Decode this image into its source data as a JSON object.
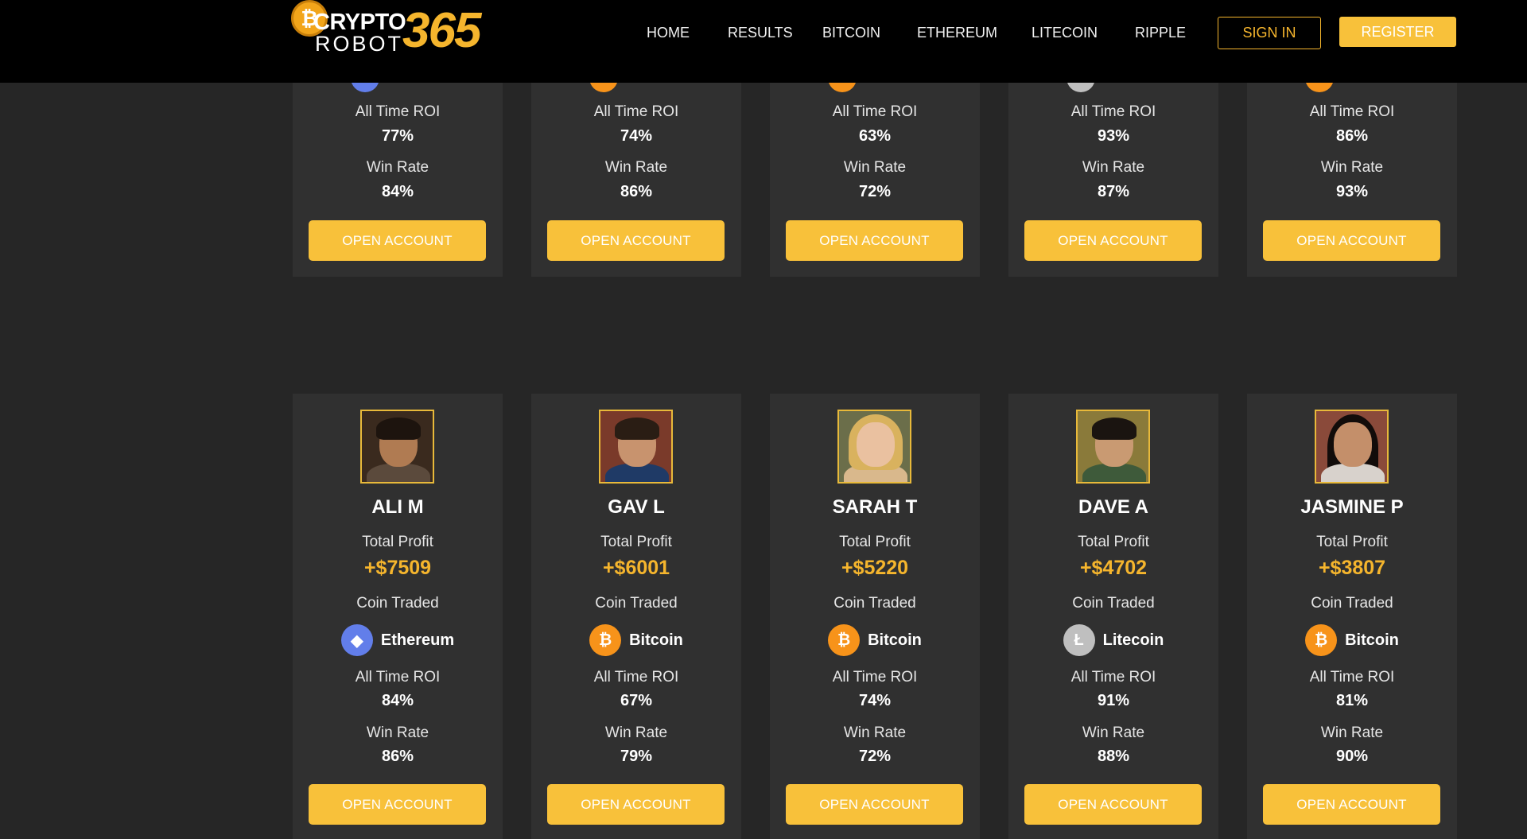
{
  "logo": {
    "line1": "CRYPTO",
    "line2": "ROBOT",
    "number": "365",
    "coin_symbol": "₿"
  },
  "nav": [
    "HOME",
    "RESULTS",
    "BITCOIN",
    "ETHEREUM",
    "LITECOIN",
    "RIPPLE"
  ],
  "auth": {
    "sign_in": "SIGN IN",
    "register": "REGISTER"
  },
  "labels": {
    "total_profit": "Total Profit",
    "coin_traded": "Coin Traded",
    "all_time_roi": "All Time ROI",
    "win_rate": "Win Rate",
    "open_account": "OPEN ACCOUNT"
  },
  "coins": {
    "Ethereum": {
      "symbol": "◆",
      "color": "#627eea",
      "icon": "ethereum-icon"
    },
    "Bitcoin": {
      "symbol": "₿",
      "color": "#f7931a",
      "icon": "bitcoin-icon"
    },
    "Litecoin": {
      "symbol": "Ł",
      "color": "#bfbfbf",
      "icon": "litecoin-icon"
    }
  },
  "top_cards": [
    {
      "coin": "Ethereum",
      "roi": "77%",
      "win_rate": "84%"
    },
    {
      "coin": "Bitcoin",
      "roi": "74%",
      "win_rate": "86%"
    },
    {
      "coin": "Bitcoin",
      "roi": "63%",
      "win_rate": "72%"
    },
    {
      "coin": "Litecoin",
      "roi": "93%",
      "win_rate": "87%"
    },
    {
      "coin": "Bitcoin",
      "roi": "86%",
      "win_rate": "93%"
    }
  ],
  "traders": [
    {
      "name": "ALI M",
      "profit": "+$7509",
      "coin": "Ethereum",
      "roi": "84%",
      "win_rate": "86%"
    },
    {
      "name": "GAV L",
      "profit": "+$6001",
      "coin": "Bitcoin",
      "roi": "67%",
      "win_rate": "79%"
    },
    {
      "name": "SARAH T",
      "profit": "+$5220",
      "coin": "Bitcoin",
      "roi": "74%",
      "win_rate": "72%"
    },
    {
      "name": "DAVE A",
      "profit": "+$4702",
      "coin": "Litecoin",
      "roi": "91%",
      "win_rate": "88%"
    },
    {
      "name": "JASMINE P",
      "profit": "+$3807",
      "coin": "Bitcoin",
      "roi": "81%",
      "win_rate": "90%"
    }
  ]
}
